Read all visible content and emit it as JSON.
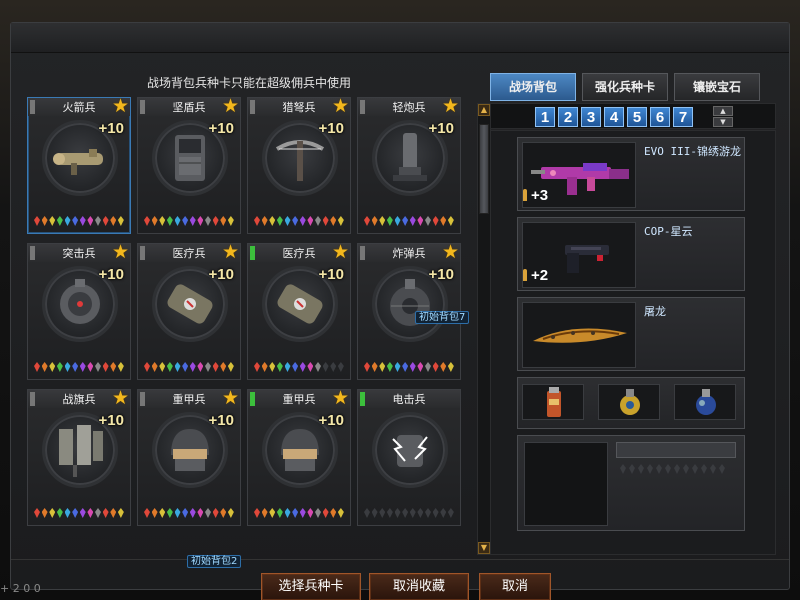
{
  "hint": "战场背包兵种卡只能在超级佣兵中使用",
  "cards": [
    {
      "name": "火箭兵",
      "plus": "+10",
      "star": "★",
      "rank": "gray",
      "weapon": "rocket-launcher"
    },
    {
      "name": "坚盾兵",
      "plus": "+10",
      "star": "★",
      "rank": "gray",
      "weapon": "shield"
    },
    {
      "name": "猎弩兵",
      "plus": "+10",
      "star": "★",
      "rank": "gray",
      "weapon": "crossbow"
    },
    {
      "name": "轻炮兵",
      "plus": "+10",
      "star": "★",
      "rank": "gray",
      "weapon": "mortar"
    },
    {
      "name": "突击兵",
      "plus": "+10",
      "star": "★",
      "rank": "gray",
      "weapon": "mine"
    },
    {
      "name": "医疗兵",
      "plus": "+10",
      "star": "★",
      "rank": "gray",
      "weapon": "medkit"
    },
    {
      "name": "医疗兵",
      "plus": "+10",
      "star": "★",
      "rank": "green",
      "weapon": "medkit"
    },
    {
      "name": "炸弹兵",
      "plus": "+10",
      "star": "★",
      "rank": "gray",
      "weapon": "bomb"
    },
    {
      "name": "战旗兵",
      "plus": "+10",
      "star": "★",
      "rank": "gray",
      "weapon": "flags"
    },
    {
      "name": "重甲兵",
      "plus": "+10",
      "star": "★",
      "rank": "gray",
      "weapon": "helmet"
    },
    {
      "name": "重甲兵",
      "plus": "+10",
      "star": "★",
      "rank": "green",
      "weapon": "helmet"
    },
    {
      "name": "电击兵",
      "plus": "",
      "star": "",
      "rank": "green",
      "weapon": "shock"
    }
  ],
  "tags": {
    "initial_bag_7": "初始背包7",
    "initial_bag_2": "初始背包2"
  },
  "tabs": [
    "战场背包",
    "强化兵种卡",
    "镶嵌宝石"
  ],
  "pages": [
    "1",
    "2",
    "3",
    "4",
    "5",
    "6",
    "7"
  ],
  "slots": [
    {
      "name": "EVO III-锦绣游龙",
      "ammo": "+3"
    },
    {
      "name": "COP-星云",
      "ammo": "+2"
    },
    {
      "name": "屠龙",
      "ammo": ""
    }
  ],
  "buttons": {
    "select": "选择兵种卡",
    "cancel_fav": "取消收藏",
    "cancel": "取消"
  },
  "footer": "+ 2 0    0"
}
